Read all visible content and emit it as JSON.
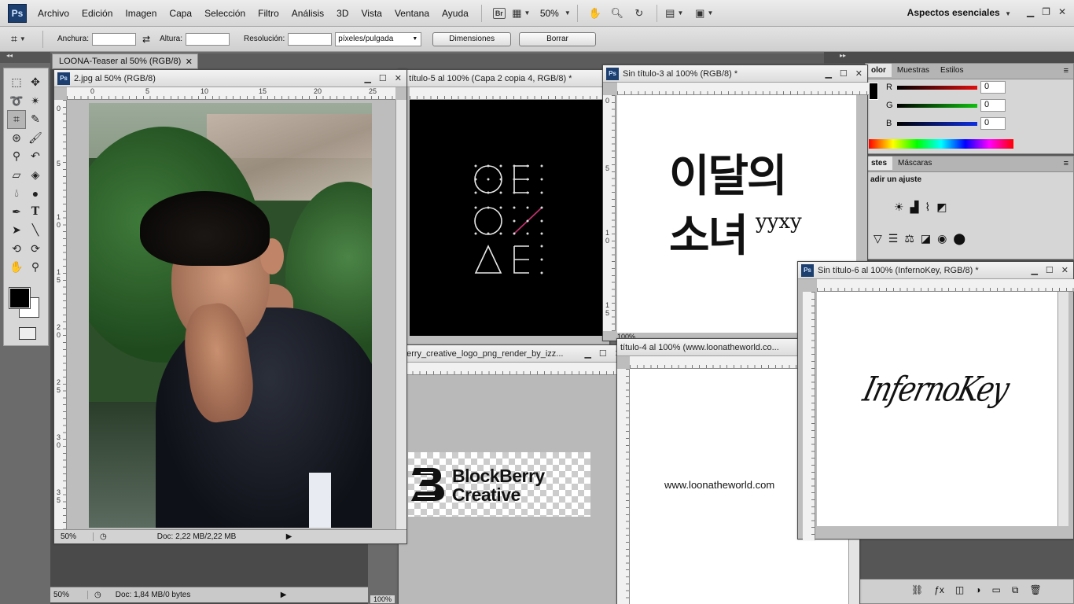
{
  "menubar": {
    "items": [
      "Archivo",
      "Edición",
      "Imagen",
      "Capa",
      "Selección",
      "Filtro",
      "Análisis",
      "3D",
      "Vista",
      "Ventana",
      "Ayuda"
    ],
    "br_label": "Br",
    "zoom": "50%",
    "workspace": "Aspectos esenciales"
  },
  "options": {
    "width_label": "Anchura:",
    "height_label": "Altura:",
    "resolution_label": "Resolución:",
    "units": "píxeles/pulgada",
    "dimensions_button": "Dimensiones",
    "clear_button": "Borrar"
  },
  "background_doc": {
    "tab_title": "LOONA-Teaser al 50% (RGB/8)",
    "zoom": "50%",
    "status": "Doc: 1,84 MB/0 bytes"
  },
  "windows": {
    "photo": {
      "title": "2.jpg al 50% (RGB/8)",
      "zoom": "50%",
      "status": "Doc: 2,22 MB/2,22 MB",
      "ruler_h": [
        "0",
        "5",
        "10",
        "15",
        "20",
        "25"
      ],
      "ruler_v": [
        "0",
        "5",
        "1 0",
        "1 5",
        "2 0",
        "2 5",
        "3 0",
        "3 5"
      ]
    },
    "logo": {
      "title": "n título-5 al 100% (Capa 2 copia 4, RGB/8) *"
    },
    "korean": {
      "title": "Sin título-3 al 100% (RGB/8) *",
      "line1": "이달의",
      "line2": "소녀",
      "superscript": "yyxy",
      "zoom": "100%",
      "ruler_v": [
        "0",
        "5",
        "1 0",
        "1 5",
        "2 0"
      ]
    },
    "blockberry": {
      "title": "berry_creative_logo_png_render_by_izz...",
      "logo_line1": "BlockBerry",
      "logo_line2": "Creative",
      "zoom": "100%"
    },
    "website": {
      "title": "título-4 al 100% (www.loonatheworld.co...",
      "text": "www.loonatheworld.com"
    },
    "inferno": {
      "title": "Sin título-6 al 100% (InfernoKey, RGB/8) *",
      "text": "InfernoKey"
    }
  },
  "panels": {
    "color_tabs": [
      "olor",
      "Muestras",
      "Estilos"
    ],
    "channels": [
      {
        "label": "R",
        "value": "0",
        "color": "#e01010"
      },
      {
        "label": "G",
        "value": "0",
        "color": "#10c010"
      },
      {
        "label": "B",
        "value": "0",
        "color": "#1030e0"
      }
    ],
    "adjust_tabs": [
      "stes",
      "Máscaras"
    ],
    "adjust_heading": "adir un ajuste"
  },
  "colors": {
    "app_bg": "#6b6b6b",
    "fg_swatch": "#000000",
    "bg_swatch": "#ffffff"
  }
}
